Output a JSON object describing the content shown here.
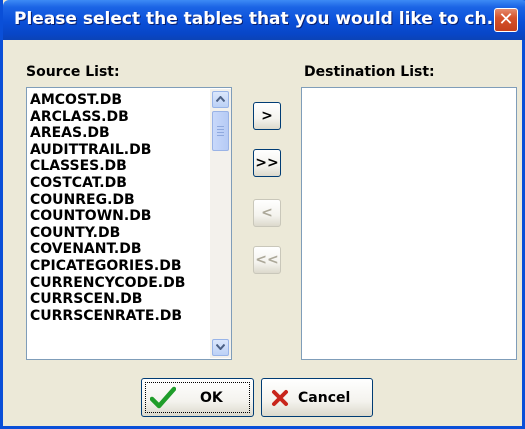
{
  "window": {
    "title": "Please select the tables that you would like to ch...",
    "close_symbol": "✕"
  },
  "source": {
    "label": "Source List:",
    "items": [
      "AMCOST.DB",
      "ARCLASS.DB",
      "AREAS.DB",
      "AUDITTRAIL.DB",
      "CLASSES.DB",
      "COSTCAT.DB",
      "COUNREG.DB",
      "COUNTOWN.DB",
      "COUNTY.DB",
      "COVENANT.DB",
      "CPICATEGORIES.DB",
      "CURRENCYCODE.DB",
      "CURRSCEN.DB",
      "CURRSCENRATE.DB"
    ]
  },
  "destination": {
    "label": "Destination List:",
    "items": []
  },
  "transfer_buttons": {
    "add_label": ">",
    "add_all_label": ">>",
    "remove_label": "<",
    "remove_all_label": "<<"
  },
  "actions": {
    "ok_label": "OK",
    "cancel_label": "Cancel"
  },
  "icons": {
    "ok": "check-icon",
    "cancel": "x-icon",
    "up": "scroll-up-icon",
    "down": "scroll-down-icon"
  },
  "colors": {
    "titlebar": "#0a4fd8",
    "dialog": "#ece9d8",
    "check": "#1f9d2a",
    "cross": "#c8251b"
  }
}
